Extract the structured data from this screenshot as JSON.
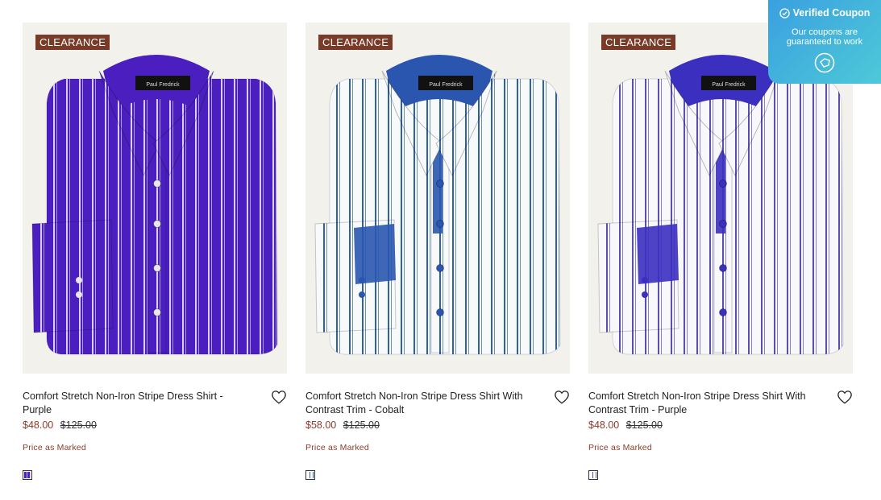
{
  "products": [
    {
      "badge": "CLEARANCE",
      "title": "Comfort Stretch Non-Iron Stripe Dress Shirt - Purple",
      "sale_price": "$48.00",
      "original_price": "$125.00",
      "promo": "Price as Marked",
      "brand_label": "Paul Fredrick",
      "shirt_color": "#4b1fbf",
      "stripe_color": "#d8cff5",
      "trim_color": "#4b1fbf",
      "swatch_color": "#4b1fbf"
    },
    {
      "badge": "CLEARANCE",
      "title": "Comfort Stretch Non-Iron Stripe Dress Shirt With Contrast Trim - Cobalt",
      "sale_price": "$58.00",
      "original_price": "$125.00",
      "promo": "Price as Marked",
      "brand_label": "Paul Fredrick",
      "shirt_color": "#f8f9fb",
      "stripe_color": "#2f5fa8",
      "trim_color": "#2a56b0",
      "swatch_color": "#ffffff"
    },
    {
      "badge": "CLEARANCE",
      "title": "Comfort Stretch Non-Iron Stripe Dress Shirt With Contrast Trim - Purple",
      "sale_price": "$48.00",
      "original_price": "$125.00",
      "promo": "Price as Marked",
      "brand_label": "Paul Fredrick",
      "shirt_color": "#f8f8fb",
      "stripe_color": "#5a4fb0",
      "trim_color": "#3b2fc0",
      "swatch_color": "#ffffff"
    }
  ],
  "coupon": {
    "title": "Verified Coupon",
    "subtitle": "Our coupons are guaranteed to work"
  },
  "icons": {
    "heart": "heart-icon",
    "check": "check-circle-icon",
    "coupon_logo": "tag-logo-icon"
  }
}
